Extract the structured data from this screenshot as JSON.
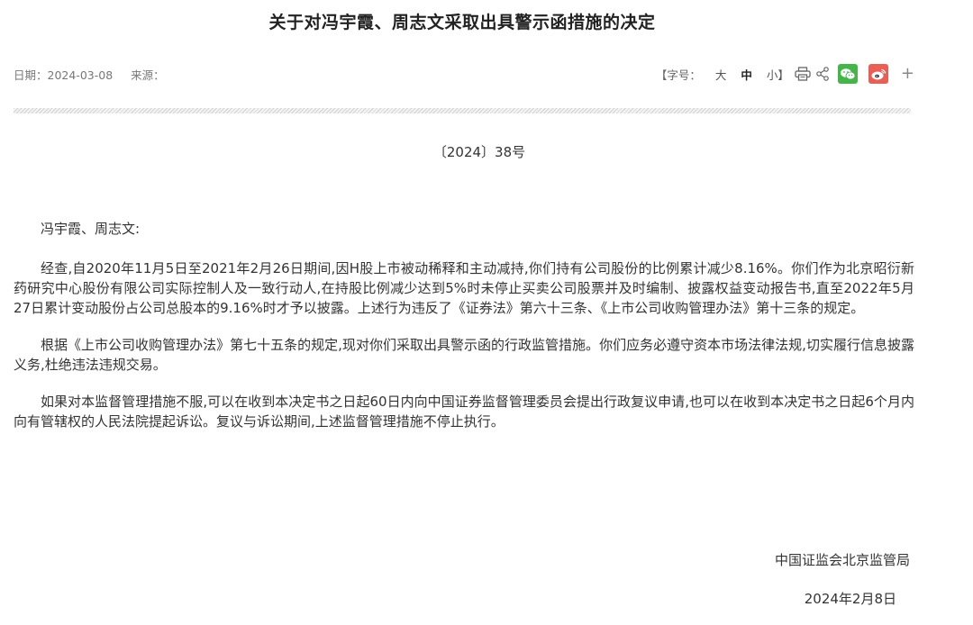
{
  "article": {
    "title": "关于对冯宇霞、周志文采取出具警示函措施的决定",
    "meta": {
      "date": "日期：2024-03-08",
      "source": "来源："
    },
    "toolbar": {
      "font_size_label": "【字号：",
      "font_large": "大",
      "font_medium": "中",
      "font_small": "小",
      "font_close": "】",
      "plus": "+"
    },
    "doc_number": "〔2024〕38号",
    "salutation": "冯宇霞、周志文:",
    "paragraphs": [
      "经查,自2020年11月5日至2021年2月26日期间,因H股上市被动稀释和主动减持,你们持有公司股份的比例累计减少8.16%。你们作为北京昭衍新药研究中心股份有限公司实际控制人及一致行动人,在持股比例减少达到5%时未停止买卖公司股票并及时编制、披露权益变动报告书,直至2022年5月27日累计变动股份占公司总股本的9.16%时才予以披露。上述行为违反了《证券法》第六十三条、《上市公司收购管理办法》第十三条的规定。",
      "根据《上市公司收购管理办法》第七十五条的规定,现对你们采取出具警示函的行政监管措施。你们应务必遵守资本市场法律法规,切实履行信息披露义务,杜绝违法违规交易。",
      "如果对本监督管理措施不服,可以在收到本决定书之日起60日内向中国证券监督管理委员会提出行政复议申请,也可以在收到本决定书之日起6个月内向有管辖权的人民法院提起诉讼。复议与诉讼期间,上述监督管理措施不停止执行。"
    ],
    "signer": "中国证监会北京监管局",
    "sign_date": "2024年2月8日"
  },
  "icons": {
    "print": "print-icon",
    "share": "share-icon",
    "wechat": "wechat-icon",
    "weibo": "weibo-icon",
    "plus": "plus-icon"
  },
  "colors": {
    "wechat": "#44b549",
    "weibo": "#e95f55",
    "text": "#333333"
  }
}
